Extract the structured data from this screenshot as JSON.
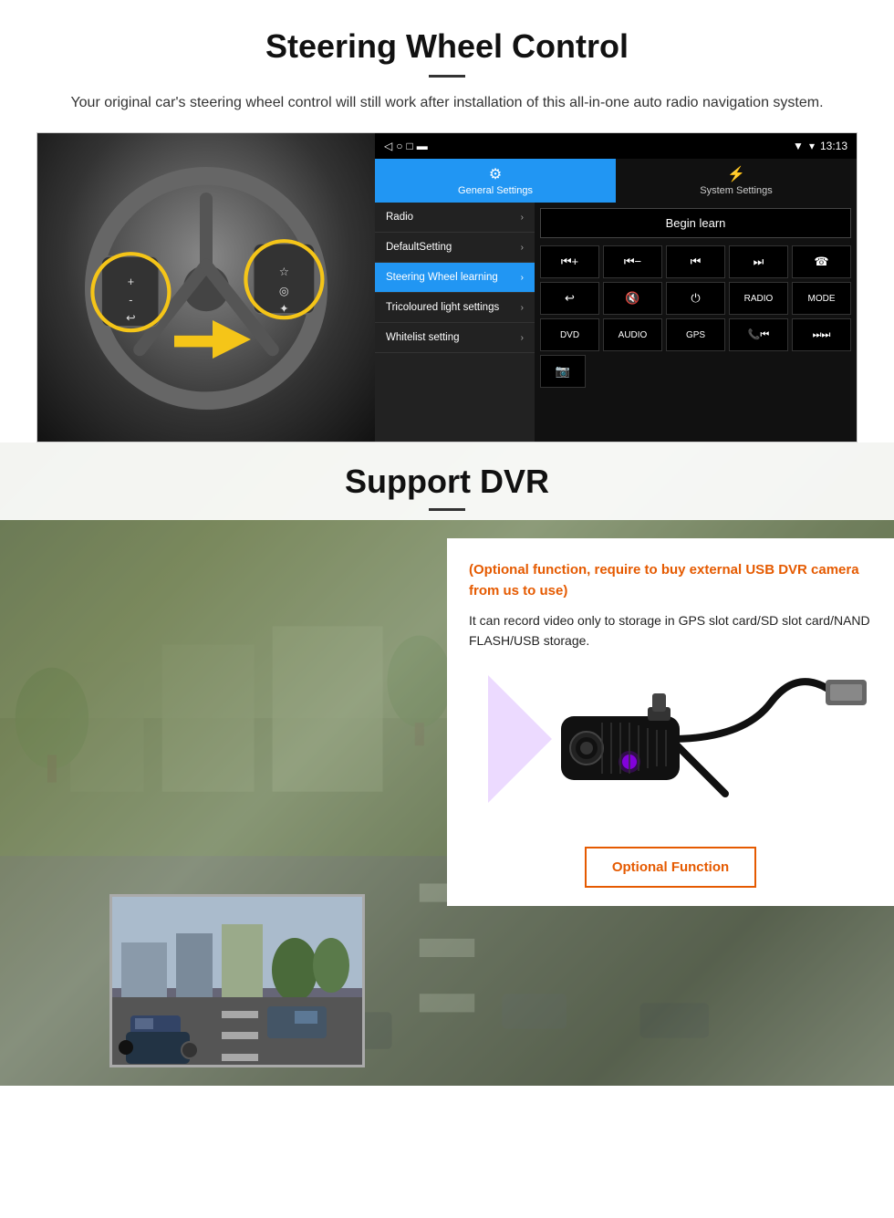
{
  "steering": {
    "title": "Steering Wheel Control",
    "subtitle": "Your original car's steering wheel control will still work after installation of this all-in-one auto radio navigation system.",
    "statusbar": {
      "time": "13:13",
      "icons": [
        "▲",
        "▼",
        "□",
        "■"
      ]
    },
    "tabs": [
      {
        "id": "general",
        "label": "General Settings",
        "active": true
      },
      {
        "id": "system",
        "label": "System Settings",
        "active": false
      }
    ],
    "menu_items": [
      {
        "label": "Radio",
        "active": false
      },
      {
        "label": "DefaultSetting",
        "active": false
      },
      {
        "label": "Steering Wheel learning",
        "active": true
      },
      {
        "label": "Tricoloured light settings",
        "active": false
      },
      {
        "label": "Whitelist setting",
        "active": false
      }
    ],
    "begin_learn": "Begin learn",
    "control_rows": [
      [
        "⏮+",
        "⏮−",
        "⏮",
        "⏭",
        "☎"
      ],
      [
        "↩",
        "🔇",
        "⏻",
        "RADIO",
        "MODE"
      ],
      [
        "DVD",
        "AUDIO",
        "GPS",
        "📞⏮",
        "⏭⏭"
      ]
    ],
    "extra_btn": "📷"
  },
  "dvr": {
    "title": "Support DVR",
    "optional_text": "(Optional function, require to buy external USB DVR camera from us to use)",
    "description": "It can record video only to storage in GPS slot card/SD slot card/NAND FLASH/USB storage.",
    "optional_function_label": "Optional Function"
  }
}
